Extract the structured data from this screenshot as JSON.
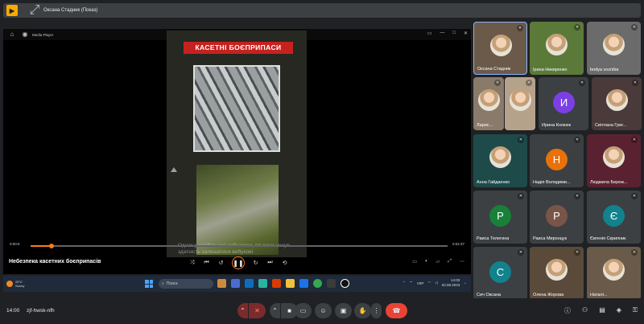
{
  "banner": {
    "title": "Оксана Стадник (Показ)"
  },
  "player": {
    "app_title": "Media Player",
    "video_title": "Небезпека касетних боєприпасів",
    "elapsed": "0:00:5",
    "total": "0:02:37",
    "progress": 0.05,
    "headline": "КАСЕТНІ БОЄПРИПАСИ",
    "caption": "Однак у найбільшої небезпеки, які вони несуть - здатність залишатися вибухові"
  },
  "taskbar": {
    "weather_temp": "25°С",
    "weather_desc": "Sunny",
    "search_placeholder": "Поиск",
    "lang": "УКР",
    "time": "14:00",
    "date": "02.08.2023"
  },
  "participants": [
    {
      "name": "Оксана Стадник",
      "type": "photo"
    },
    {
      "name": "Ірина Никиренко",
      "type": "photo",
      "bg": "#5b7a3a"
    },
    {
      "name": "bodya vozniba",
      "type": "photo",
      "bg": "#6b6b6b"
    },
    {
      "name": "Ларис...",
      "type": "photo",
      "bg": "#8a7a6a"
    },
    {
      "name": "",
      "type": "photo",
      "bg": "#b5a28a"
    },
    {
      "name": "Ирина Князюк",
      "type": "letter",
      "letter": "И",
      "color": "#7b3fe4"
    },
    {
      "name": "Світлана Григ...",
      "type": "photo",
      "bg": "#4a3a3a"
    },
    {
      "name": "Анна Гайдаенко",
      "type": "photo",
      "bg": "#1e4a4a"
    },
    {
      "name": "Надія Володими...",
      "type": "letter",
      "letter": "Н",
      "color": "#e8710a"
    },
    {
      "name": "Людмила Береж...",
      "type": "photo",
      "bg": "#5a2230"
    },
    {
      "name": "Раиса Телегина",
      "type": "letter",
      "letter": "Р",
      "color": "#188038"
    },
    {
      "name": "Раиса Миронцук",
      "type": "letter",
      "letter": "Р",
      "color": "#795548"
    },
    {
      "name": "Євгенія Скрипник",
      "type": "letter",
      "letter": "Є",
      "color": "#12828c"
    },
    {
      "name": "Сич Оксана",
      "type": "letter",
      "letter": "С",
      "color": "#12828c"
    },
    {
      "name": "Олена Жорова",
      "type": "photo",
      "bg": "#5a4a3a"
    },
    {
      "name": "Наталі...",
      "type": "photo",
      "bg": "#6a5a4a"
    }
  ],
  "bottom": {
    "time": "14:00",
    "meeting_code": "zjf-hwsk-nfh"
  },
  "icons": {
    "share": "present-icon",
    "more": "more-vert-icon"
  },
  "colors": {
    "accent": "#fa7b17",
    "end_call": "#ea4335"
  }
}
